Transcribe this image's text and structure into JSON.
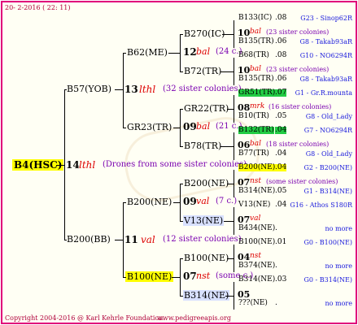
{
  "header": {
    "date": "20-  2-2016 ( 22: 11)"
  },
  "root": {
    "name": "B4(HSC)",
    "gen": "14",
    "race": "lthl",
    "note": "(Drones from some sister colonies)"
  },
  "gen1": [
    {
      "name": "B57(YOB)",
      "gen": "13",
      "race": "lthl",
      "note": "(32 sister colonies)"
    },
    {
      "name": "B200(BB)",
      "gen": "11",
      "race": "val",
      "note": "(12 sister colonies)"
    }
  ],
  "gen2": [
    {
      "name": "B62(ME)",
      "gen": "12",
      "race": "bal",
      "note": "(24 c.)"
    },
    {
      "name": "GR23(TR)",
      "gen": "09",
      "race": "bal",
      "note": "(21 c.)"
    },
    {
      "name": "B200(NE)",
      "gen": "09",
      "race": "val",
      "note": "(7 c.)"
    },
    {
      "name": "B100(NE)",
      "gen": "07",
      "race": "nst",
      "note": "(some c.)"
    }
  ],
  "gen3": [
    {
      "name": "B270(IC)"
    },
    {
      "name": "B72(TR)"
    },
    {
      "name": "GR22(TR)"
    },
    {
      "name": "B78(TR)"
    },
    {
      "name": "B200(NE)"
    },
    {
      "name": "V13(NE)"
    },
    {
      "name": "B100(NE)"
    },
    {
      "name": "B314(NE)"
    }
  ],
  "gen3info": [
    {
      "gen": "10",
      "race": "bal",
      "note": "(23 sister colonies)"
    },
    {
      "gen": "10",
      "race": "bal",
      "note": "(23 sister colonies)"
    },
    {
      "gen": "08",
      "race": "mrk",
      "note": "(16 sister colonies)"
    },
    {
      "gen": "06",
      "race": "bal",
      "note": "(18 sister colonies)"
    },
    {
      "gen": "07",
      "race": "nst",
      "note": "(some sister colonies)"
    },
    {
      "gen": "07",
      "race": "val",
      "note": ""
    },
    {
      "gen": "04",
      "race": "nst",
      "note": ""
    },
    {
      "gen": "05",
      "race": "",
      "note": ""
    }
  ],
  "gen4": [
    {
      "name": "B133(IC)",
      "num": ".08",
      "right": "G23 - Sinop62R"
    },
    {
      "name": "B135(TR)",
      "num": ".06",
      "right": "G8 - Takab93aR"
    },
    {
      "name": "B68(TR)",
      "num": ".08",
      "right": "G10 - NO6294R"
    },
    {
      "name": "B135(TR)",
      "num": ".06",
      "right": "G8 - Takab93aR"
    },
    {
      "name": "GR51(TR)",
      "num": ".07",
      "right": "G1 - Gr.R.mounta"
    },
    {
      "name": "B10(TR)",
      "num": ".05",
      "right": "G8 - Old_Lady"
    },
    {
      "name": "B132(TR)",
      "num": ".04",
      "right": "G7 - NO6294R"
    },
    {
      "name": "B77(TR)",
      "num": ".04",
      "right": "G8 - Old_Lady"
    },
    {
      "name": "B200(NE)",
      "num": ".04",
      "right": "G2 - B200(NE)"
    },
    {
      "name": "B314(NE)",
      "num": ".05",
      "right": "G1 - B314(NE)"
    },
    {
      "name": "V13(NE)",
      "num": ".04",
      "right": "G16 - Athos S180R"
    },
    {
      "name": "B434(NE)",
      "num": ".",
      "right": "no more"
    },
    {
      "name": "B100(NE)",
      "num": ".01",
      "right": "G0 - B100(NE)"
    },
    {
      "name": "B374(NE)",
      "num": ".",
      "right": "no more"
    },
    {
      "name": "B314(NE)",
      "num": ".03",
      "right": "G0 - B314(NE)"
    },
    {
      "name": "???(NE)",
      "num": ".",
      "right": "no more"
    }
  ],
  "footer": {
    "copyright": "Copyright 2004-2016 @ Karl Kehrle Foundation.",
    "url": "www.pedigreeapis.org"
  }
}
